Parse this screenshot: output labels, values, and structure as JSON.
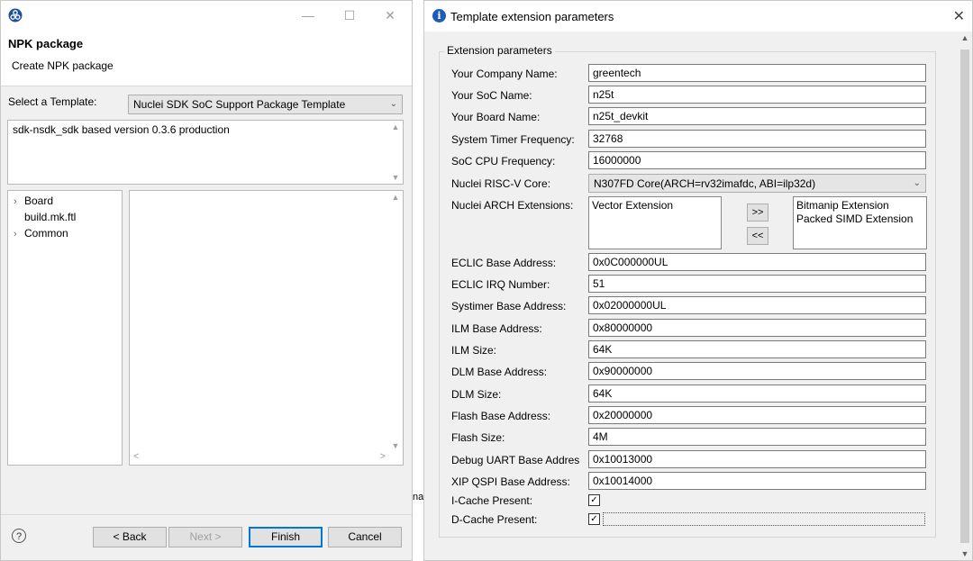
{
  "npk": {
    "header_title": "NPK package",
    "header_subtitle": "Create NPK package",
    "template_label": "Select a Template:",
    "template_value": "Nuclei SDK SoC Support Package Template",
    "description": "sdk-nsdk_sdk based version 0.3.6 production",
    "tree": [
      "Board",
      "build.mk.ftl",
      "Common"
    ],
    "buttons": {
      "back": "< Back",
      "next": "Next >",
      "finish": "Finish",
      "cancel": "Cancel"
    },
    "help": "?",
    "peek_text": "nal"
  },
  "dialog": {
    "title": "Template extension parameters",
    "group_title": "Extension parameters",
    "fields": {
      "company": {
        "label": "Your Company Name:",
        "value": "greentech"
      },
      "soc": {
        "label": "Your SoC Name:",
        "value": "n25t"
      },
      "board": {
        "label": "Your Board Name:",
        "value": "n25t_devkit"
      },
      "timer_freq": {
        "label": "System Timer Frequency:",
        "value": "32768"
      },
      "cpu_freq": {
        "label": "SoC CPU Frequency:",
        "value": "16000000"
      },
      "core": {
        "label": "Nuclei RISC-V Core:",
        "value": "N307FD Core(ARCH=rv32imafdc, ABI=ilp32d)"
      },
      "arch_ext": {
        "label": "Nuclei ARCH Extensions:",
        "available": [
          "Vector Extension"
        ],
        "selected": [
          "Bitmanip Extension",
          "Packed SIMD Extension"
        ],
        "add_button": ">>",
        "remove_button": "<<"
      },
      "eclic_base": {
        "label": "ECLIC Base Address:",
        "value": "0x0C000000UL"
      },
      "eclic_irq": {
        "label": "ECLIC IRQ Number:",
        "value": "51"
      },
      "systimer_base": {
        "label": "Systimer Base Address:",
        "value": "0x02000000UL"
      },
      "ilm_base": {
        "label": "ILM Base Address:",
        "value": "0x80000000"
      },
      "ilm_size": {
        "label": "ILM Size:",
        "value": "64K"
      },
      "dlm_base": {
        "label": "DLM Base Address:",
        "value": "0x90000000"
      },
      "dlm_size": {
        "label": "DLM Size:",
        "value": "64K"
      },
      "flash_base": {
        "label": "Flash Base Address:",
        "value": "0x20000000"
      },
      "flash_size": {
        "label": "Flash Size:",
        "value": "4M"
      },
      "uart_base": {
        "label": "Debug UART Base Addres",
        "value": "0x10013000"
      },
      "xip_base": {
        "label": "XIP QSPI Base Address:",
        "value": "0x10014000"
      },
      "icache": {
        "label": "I-Cache Present:",
        "checked": true
      },
      "dcache": {
        "label": "D-Cache Present:",
        "checked": true
      }
    }
  },
  "colors": {
    "accent": "#0078d7",
    "info_icon": "#1e5bb8",
    "dialog_bg": "#f0f0f0"
  }
}
